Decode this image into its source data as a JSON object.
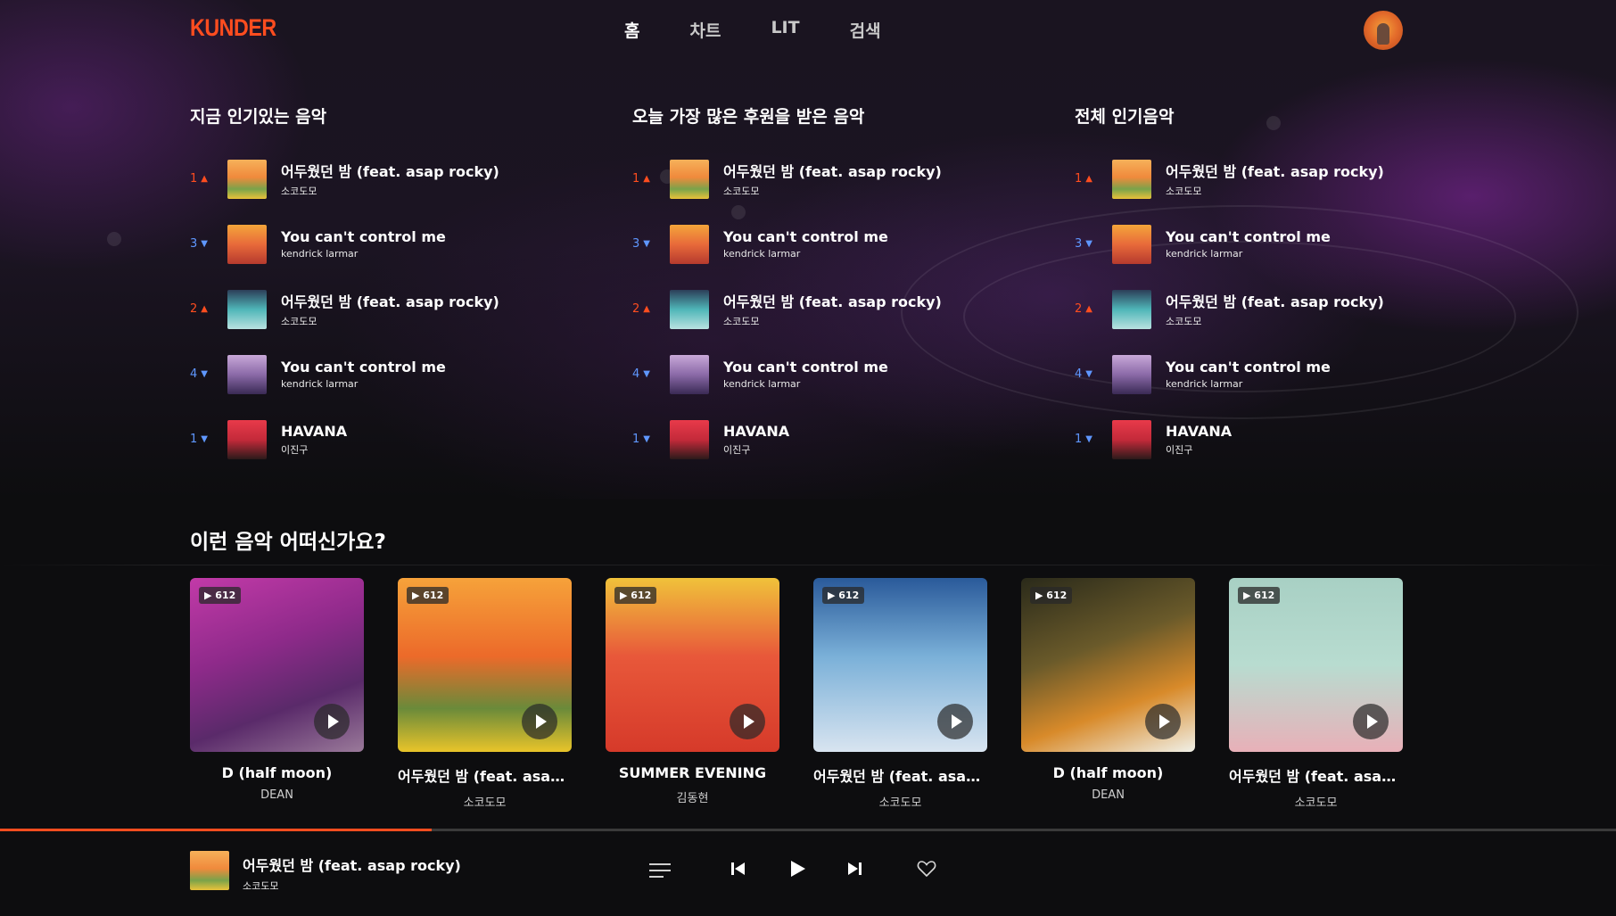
{
  "header": {
    "logo": "KUNDER",
    "nav": [
      "홈",
      "차트",
      "LIT",
      "검색"
    ]
  },
  "columns": [
    {
      "title": "지금 인기있는 음악",
      "items": [
        {
          "rank": "1",
          "dir": "up",
          "title": "어두웠던 밤 (feat. asap rocky)",
          "artist": "소코도모"
        },
        {
          "rank": "3",
          "dir": "down",
          "title": "You can't control me",
          "artist": "kendrick larmar"
        },
        {
          "rank": "2",
          "dir": "up",
          "title": "어두웠던 밤 (feat. asap rocky)",
          "artist": "소코도모"
        },
        {
          "rank": "4",
          "dir": "down",
          "title": "You can't control me",
          "artist": "kendrick larmar"
        },
        {
          "rank": "1",
          "dir": "down",
          "title": "HAVANA",
          "artist": "이진구"
        }
      ]
    },
    {
      "title": "오늘 가장 많은 후원을 받은 음악",
      "items": [
        {
          "rank": "1",
          "dir": "up",
          "title": "어두웠던 밤 (feat. asap rocky)",
          "artist": "소코도모"
        },
        {
          "rank": "3",
          "dir": "down",
          "title": "You can't control me",
          "artist": "kendrick larmar"
        },
        {
          "rank": "2",
          "dir": "up",
          "title": "어두웠던 밤 (feat. asap rocky)",
          "artist": "소코도모"
        },
        {
          "rank": "4",
          "dir": "down",
          "title": "You can't control me",
          "artist": "kendrick larmar"
        },
        {
          "rank": "1",
          "dir": "down",
          "title": "HAVANA",
          "artist": "이진구"
        }
      ]
    },
    {
      "title": "전체 인기음악",
      "items": [
        {
          "rank": "1",
          "dir": "up",
          "title": "어두웠던 밤 (feat. asap rocky)",
          "artist": "소코도모"
        },
        {
          "rank": "3",
          "dir": "down",
          "title": "You can't control me",
          "artist": "kendrick larmar"
        },
        {
          "rank": "2",
          "dir": "up",
          "title": "어두웠던 밤 (feat. asap rocky)",
          "artist": "소코도모"
        },
        {
          "rank": "4",
          "dir": "down",
          "title": "You can't control me",
          "artist": "kendrick larmar"
        },
        {
          "rank": "1",
          "dir": "down",
          "title": "HAVANA",
          "artist": "이진구"
        }
      ]
    }
  ],
  "recommend": {
    "title": "이런 음악 어떠신가요?",
    "cards": [
      {
        "plays": "612",
        "title": "D (half moon)",
        "artist": "DEAN"
      },
      {
        "plays": "612",
        "title": "어두웠던 밤 (feat. asap ro..",
        "artist": "소코도모"
      },
      {
        "plays": "612",
        "title": "SUMMER EVENING",
        "artist": "김동현"
      },
      {
        "plays": "612",
        "title": "어두웠던 밤 (feat. asap ro..",
        "artist": "소코도모"
      },
      {
        "plays": "612",
        "title": "D (half moon)",
        "artist": "DEAN"
      },
      {
        "plays": "612",
        "title": "어두웠던 밤 (feat. asap ro..",
        "artist": "소코도모"
      }
    ]
  },
  "player": {
    "title": "어두웠던 밤 (feat. asap rocky)",
    "artist": "소코도모",
    "progress": 0.267
  },
  "colors": {
    "accent": "#ff4d1f",
    "rank_up": "#ff4d1f",
    "rank_down": "#5f97ff"
  },
  "icons": [
    "avatar",
    "queue-add-icon",
    "previous-icon",
    "play-icon",
    "next-icon",
    "heart-icon",
    "play-count-icon"
  ]
}
